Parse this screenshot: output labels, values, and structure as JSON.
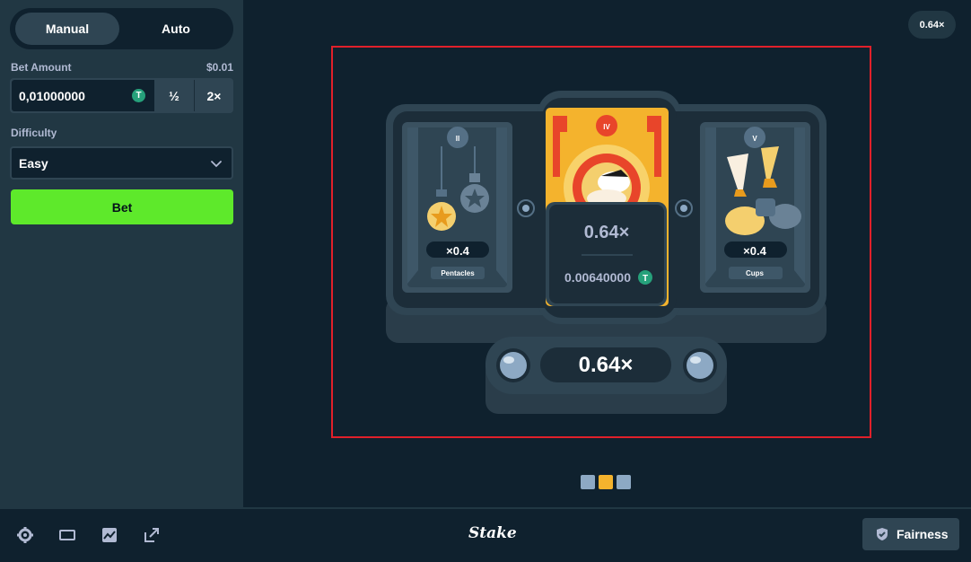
{
  "sidebar": {
    "mode_manual": "Manual",
    "mode_auto": "Auto",
    "bet_amount_label": "Bet Amount",
    "bet_amount_usd": "$0.01",
    "bet_amount_value": "0,01000000",
    "half_label": "½",
    "double_label": "2×",
    "difficulty_label": "Difficulty",
    "difficulty_value": "Easy",
    "bet_button": "Bet"
  },
  "game": {
    "result_badge": "0.64×",
    "cards": [
      {
        "numeral": "II",
        "multiplier": "×0.4",
        "name": "Pentacles"
      },
      {
        "numeral": "IV",
        "multiplier": "0.64×",
        "payout": "0.00640000"
      },
      {
        "numeral": "V",
        "multiplier": "×0.4",
        "name": "Cups"
      }
    ],
    "total_multiplier": "0.64×",
    "progress_dots": [
      "#8da9c4",
      "#f4b32d",
      "#8da9c4"
    ]
  },
  "footer": {
    "logo": "Stake",
    "fairness_label": "Fairness"
  },
  "colors": {
    "accent_green": "#5ee92b",
    "sidebar_bg": "#213743",
    "main_bg": "#0f212e",
    "highlight": "#e0202a",
    "card_gold": "#f4b32d"
  }
}
